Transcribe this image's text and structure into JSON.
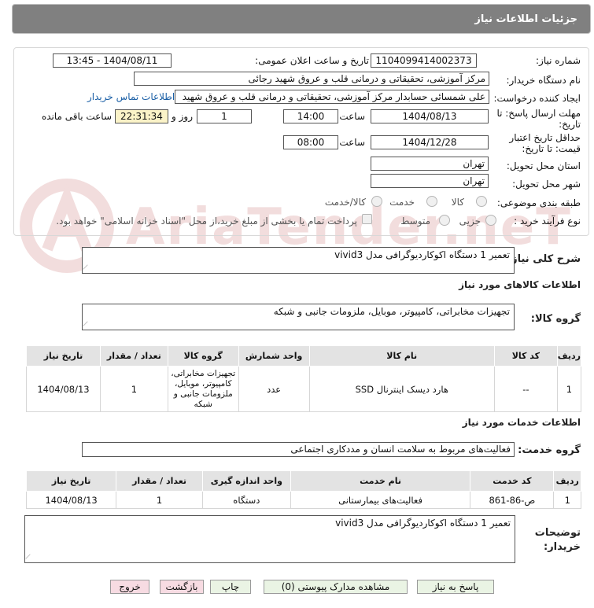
{
  "header": {
    "title": "جزئیات اطلاعات نیاز"
  },
  "watermark": {
    "text": "AriaTender.neT"
  },
  "fields": {
    "need_number_label": "شماره نیاز:",
    "need_number": "1104099414002373",
    "announce_label": "تاریخ و ساعت اعلان عمومی:",
    "announce_value": "1404/08/11 - 13:45",
    "buyer_org_label": "نام دستگاه خریدار:",
    "buyer_org": "مرکز آموزشی، تحقیقاتی و درمانی قلب و عروق شهید رجائی",
    "creator_label": "ایجاد کننده درخواست:",
    "creator": "علی شمسائی حسابدار مرکز آموزشی، تحقیقاتی و درمانی قلب و عروق شهید",
    "contact_link": "اطلاعات تماس خریدار",
    "deadline_label_1": "مهلت ارسال پاسخ: تا",
    "deadline_label_2": "تاریخ:",
    "deadline_date": "1404/08/13",
    "time_label": "ساعت",
    "deadline_time": "14:00",
    "days_value": "1",
    "days_label": "روز و",
    "remaining_time": "22:31:34",
    "remaining_label": "ساعت باقی مانده",
    "validity_label_1": "حداقل تاریخ اعتبار",
    "validity_label_2": "قیمت: تا تاریخ:",
    "validity_date": "1404/12/28",
    "validity_time": "08:00",
    "province_label": "استان محل تحویل:",
    "province": "تهران",
    "city_label": "شهر محل تحویل:",
    "city": "تهران",
    "category_label": "طبقه بندی موضوعی:",
    "category_options": [
      "کالا",
      "خدمت",
      "کالا/خدمت"
    ],
    "process_label": "نوع فرآیند خرید :",
    "process_options": [
      "جزیی",
      "متوسط"
    ],
    "payment_note": "پرداخت تمام یا بخشی از مبلغ خرید،از محل \"اسناد خزانه اسلامی\" خواهد بود."
  },
  "summary": {
    "label": "شرح کلی نیاز:",
    "value": "تعمیر 1 دستگاه اکوکاردیوگرافی مدل vivid3"
  },
  "goods": {
    "section_title": "اطلاعات کالاهای مورد نیاز",
    "group_label": "گروه کالا:",
    "group_value": "تجهیزات مخابراتی، کامپیوتر، موبایل، ملزومات جانبی و شبکه",
    "columns": [
      "ردیف",
      "کد کالا",
      "نام کالا",
      "واحد شمارش",
      "گروه کالا",
      "تعداد / مقدار",
      "تاریخ نیاز"
    ],
    "rows": [
      {
        "row": "1",
        "code": "--",
        "name": "هارد دیسک اینترنال SSD",
        "unit": "عدد",
        "group_lines": [
          "تجهیزات مخابراتی،",
          "کامپیوتر، موبایل،",
          "ملزومات جانبی و",
          "شبکه"
        ],
        "qty": "1",
        "date": "1404/08/13"
      }
    ]
  },
  "services": {
    "section_title": "اطلاعات خدمات مورد نیاز",
    "group_label": "گروه خدمت:",
    "group_value": "فعالیت‌های مربوط به سلامت انسان و مددکاری اجتماعی",
    "columns": [
      "ردیف",
      "کد خدمت",
      "نام خدمت",
      "واحد اندازه گیری",
      "تعداد / مقدار",
      "تاریخ نیاز"
    ],
    "rows": [
      {
        "row": "1",
        "code": "ص-86-861",
        "name": "فعالیت‌های بیمارستانی",
        "unit": "دستگاه",
        "qty": "1",
        "date": "1404/08/13"
      }
    ]
  },
  "buyer_notes": {
    "label_1": "توضیحات",
    "label_2": "خریدار:",
    "value": "تعمیر 1 دستگاه اکوکاردیوگرافی مدل vivid3"
  },
  "buttons": {
    "reply": "پاسخ به نیاز",
    "attachments": "مشاهده مدارک پیوستی (0)",
    "print": "چاپ",
    "back": "بازگشت",
    "exit": "خروج"
  },
  "colors": {
    "header_bg": "#808080",
    "goods_table_header": "#e3e3e3",
    "time_highlight": "#fbf3c8",
    "button_green": "#eaf4e4",
    "button_pink": "#f7dbe2",
    "link": "#1a5fa6"
  }
}
